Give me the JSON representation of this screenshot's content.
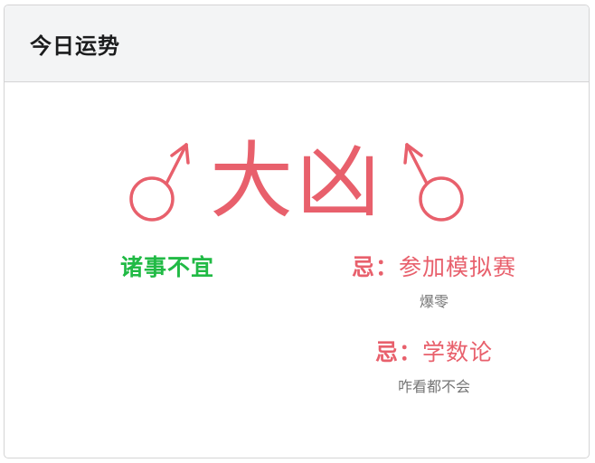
{
  "card": {
    "title": "今日运势"
  },
  "fortune": {
    "text": "大凶",
    "color": "#e8606c",
    "left_icon": "mars-icon",
    "right_icon": "mars-icon"
  },
  "good": {
    "title": "诸事不宜",
    "color": "#21ba45"
  },
  "bad": {
    "items": [
      {
        "prefix": "忌：",
        "title": "参加模拟赛",
        "desc": "爆零"
      },
      {
        "prefix": "忌：",
        "title": "学数论",
        "desc": "咋看都不会"
      }
    ]
  }
}
